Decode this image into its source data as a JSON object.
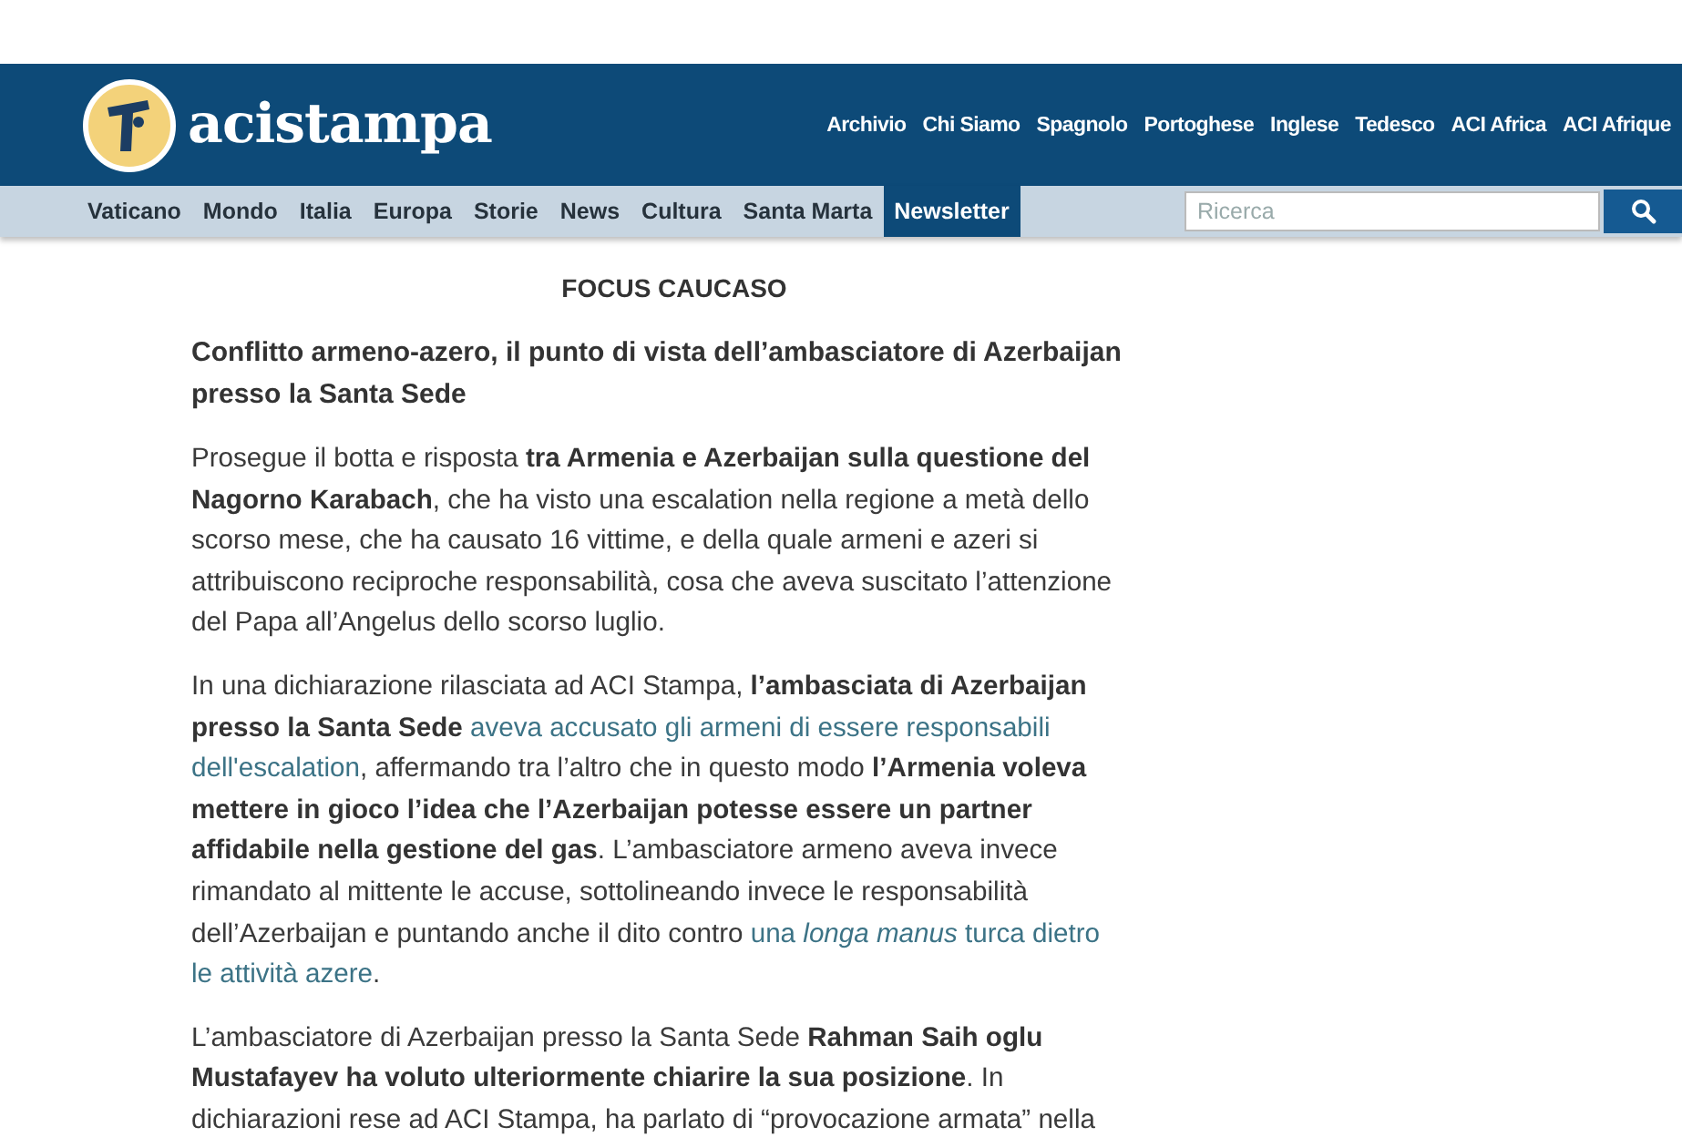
{
  "header": {
    "logo_text": "acistampa",
    "links": [
      "Archivio",
      "Chi Siamo",
      "Spagnolo",
      "Portoghese",
      "Inglese",
      "Tedesco",
      "ACI Africa",
      "ACI Afrique"
    ]
  },
  "nav": {
    "items": [
      {
        "label": "Vaticano",
        "selected": false
      },
      {
        "label": "Mondo",
        "selected": false
      },
      {
        "label": "Italia",
        "selected": false
      },
      {
        "label": "Europa",
        "selected": false
      },
      {
        "label": "Storie",
        "selected": false
      },
      {
        "label": "News",
        "selected": false
      },
      {
        "label": "Cultura",
        "selected": false
      },
      {
        "label": "Santa Marta",
        "selected": false
      },
      {
        "label": "Newsletter",
        "selected": true
      }
    ],
    "search": {
      "placeholder": "Ricerca"
    }
  },
  "article": {
    "section": "FOCUS CAUCASO",
    "title": "Conflitto armeno-azero, il punto di vista dell’ambasciatore di Azerbaijan presso la Santa Sede",
    "paragraphs": [
      {
        "lines": [
          [
            {
              "kind": "plain",
              "text": "Prosegue il botta e risposta "
            },
            {
              "kind": "bold",
              "text": "tra Armenia e Azerbaijan sulla questione del"
            }
          ],
          [
            {
              "kind": "bold",
              "text": "Nagorno Karabach"
            },
            {
              "kind": "plain",
              "text": ", che ha visto una escalation nella regione a metà dello"
            }
          ],
          [
            {
              "kind": "plain",
              "text": "scorso mese, che ha causato 16 vittime, e della quale armeni e azeri si"
            }
          ],
          [
            {
              "kind": "plain",
              "text": "attribuiscono reciproche responsabilità, cosa che aveva suscitato l’attenzione"
            }
          ],
          [
            {
              "kind": "plain",
              "text": "del Papa all’Angelus dello scorso luglio."
            }
          ]
        ]
      },
      {
        "lines": [
          [
            {
              "kind": "plain",
              "text": "In una dichiarazione rilasciata ad ACI Stampa, "
            },
            {
              "kind": "bold",
              "text": "l’ambasciata di Azerbaijan"
            }
          ],
          [
            {
              "kind": "bold",
              "text": "presso la Santa Sede "
            },
            {
              "kind": "link",
              "text": "aveva accusato gli armeni di essere responsabili"
            }
          ],
          [
            {
              "kind": "link",
              "text": "dell'escalation"
            },
            {
              "kind": "plain",
              "text": ", affermando tra l’altro che in questo modo "
            },
            {
              "kind": "bold",
              "text": "l’Armenia voleva"
            }
          ],
          [
            {
              "kind": "bold",
              "text": "mettere in gioco l’idea che l’Azerbaijan potesse essere un partner"
            }
          ],
          [
            {
              "kind": "bold",
              "text": "affidabile nella gestione del gas"
            },
            {
              "kind": "plain",
              "text": ". L’ambasciatore armeno aveva invece"
            }
          ],
          [
            {
              "kind": "plain",
              "text": "rimandato al mittente le accuse, sottolineando invece le responsabilità"
            }
          ],
          [
            {
              "kind": "plain",
              "text": "dell’Azerbaijan e puntando anche il dito contro "
            },
            {
              "kind": "link",
              "text": "una *longa manus* turca dietro"
            }
          ],
          [
            {
              "kind": "link",
              "text": "le attività azere"
            },
            {
              "kind": "plain",
              "text": "."
            }
          ]
        ]
      },
      {
        "lines": [
          [
            {
              "kind": "plain",
              "text": "L’ambasciatore di Azerbaijan presso la Santa Sede "
            },
            {
              "kind": "bold",
              "text": "Rahman Saih oglu"
            }
          ],
          [
            {
              "kind": "bold",
              "text": "Mustafayev ha voluto ulteriormente chiarire la sua posizione"
            },
            {
              "kind": "plain",
              "text": ". In"
            }
          ],
          [
            {
              "kind": "plain",
              "text": "dichiarazioni rese ad ACI Stampa, ha parlato di “provocazione armata” nella"
            }
          ]
        ]
      }
    ]
  }
}
